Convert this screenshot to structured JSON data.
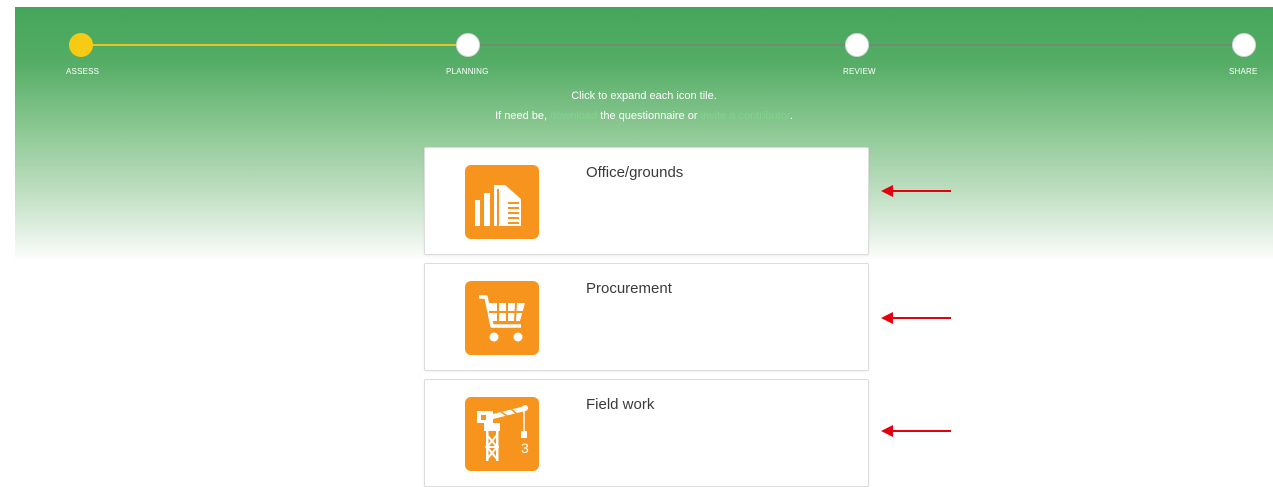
{
  "stepper": {
    "steps": [
      {
        "label": "ASSESS",
        "state": "active"
      },
      {
        "label": "PLANNING",
        "state": "pending"
      },
      {
        "label": "REVIEW",
        "state": "pending"
      },
      {
        "label": "SHARE",
        "state": "pending"
      }
    ]
  },
  "instructions": {
    "line1": "Click to expand each icon tile.",
    "prefix": "If need be, ",
    "download_link": "download",
    "middle": " the questionnaire or ",
    "invite_link": "invite a contributor",
    "suffix": "."
  },
  "tiles": [
    {
      "label": "Office/grounds",
      "icon": "office-building-icon"
    },
    {
      "label": "Procurement",
      "icon": "shopping-cart-icon"
    },
    {
      "label": "Field work",
      "icon": "construction-crane-icon"
    }
  ],
  "colors": {
    "header_green": "#44a55a",
    "active_step": "#f7cb14",
    "tile_icon_bg": "#f7941d",
    "annotation_arrow": "#e3000f",
    "link_green": "#7fd489"
  }
}
